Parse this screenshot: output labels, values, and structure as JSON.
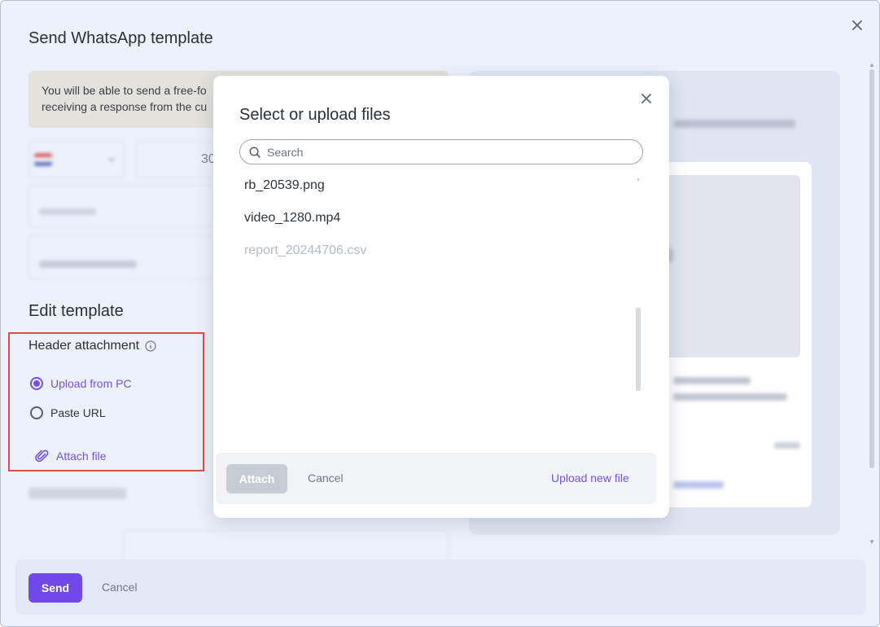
{
  "colors": {
    "accent": "#7149ea",
    "highlight": "#e24b4b",
    "disabled": "#c8ccd4"
  },
  "outer_modal": {
    "title": "Send WhatsApp template",
    "notice_line1": "You will be able to send a free-fo",
    "notice_line2": "receiving a response from the cu",
    "phone_value": "30",
    "header": {
      "title": "Edit template",
      "attachment_label": "Header attachment"
    },
    "attachment_options": [
      {
        "label": "Upload from PC",
        "checked": true
      },
      {
        "label": "Paste URL",
        "checked": false
      }
    ],
    "attach_link": "Attach file",
    "footer": {
      "send_label": "Send",
      "cancel_label": "Cancel"
    }
  },
  "dialog": {
    "title": "Select or upload files",
    "search": {
      "placeholder": "Search",
      "value": ""
    },
    "files": [
      {
        "name": "rb_20539.png",
        "disabled": false
      },
      {
        "name": "video_1280.mp4",
        "disabled": false
      },
      {
        "name": "report_20244706.csv",
        "disabled": true
      }
    ],
    "footer": {
      "attach_label": "Attach",
      "cancel_label": "Cancel",
      "upload_label": "Upload new file"
    }
  },
  "icons": {
    "close": "close-icon",
    "info": "info-icon",
    "search": "search-icon",
    "paperclip": "paperclip-icon"
  }
}
